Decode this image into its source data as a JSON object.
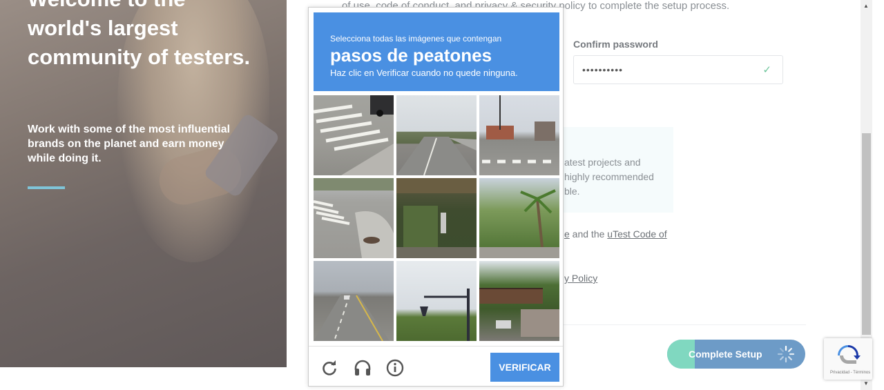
{
  "hero": {
    "heading": "Welcome to the world's largest community of testers.",
    "subtext": "Work with some of the most influential brands on the planet and earn money while doing it."
  },
  "form": {
    "terms_partial": "of use, code of conduct, and privacy & security policy to complete the setup process.",
    "confirm_password_label": "Confirm password",
    "confirm_password_value": "••••••••••",
    "info_lines": [
      "atest projects and",
      "highly recommended",
      "ble."
    ],
    "agree_prefix": "e",
    "agree_mid": " and the ",
    "agree_link": "uTest Code of",
    "privacy_link": "y Policy",
    "complete_button": "Complete Setup",
    "progress": 0.2
  },
  "captcha": {
    "instruction": "Selecciona todas las imágenes que contengan",
    "target": "pasos de peatones",
    "hint": "Haz clic en Verificar cuando no quede ninguna.",
    "verify_label": "VERIFICAR",
    "icons": [
      "reload-icon",
      "audio-icon",
      "info-icon"
    ]
  },
  "recaptcha_badge": {
    "text": "Privacidad - Términos"
  },
  "colors": {
    "captcha_blue": "#4a90e2",
    "button_blue": "#6d9bc7",
    "button_progress": "#80d8c0",
    "accent_line": "#7fc4d8"
  }
}
